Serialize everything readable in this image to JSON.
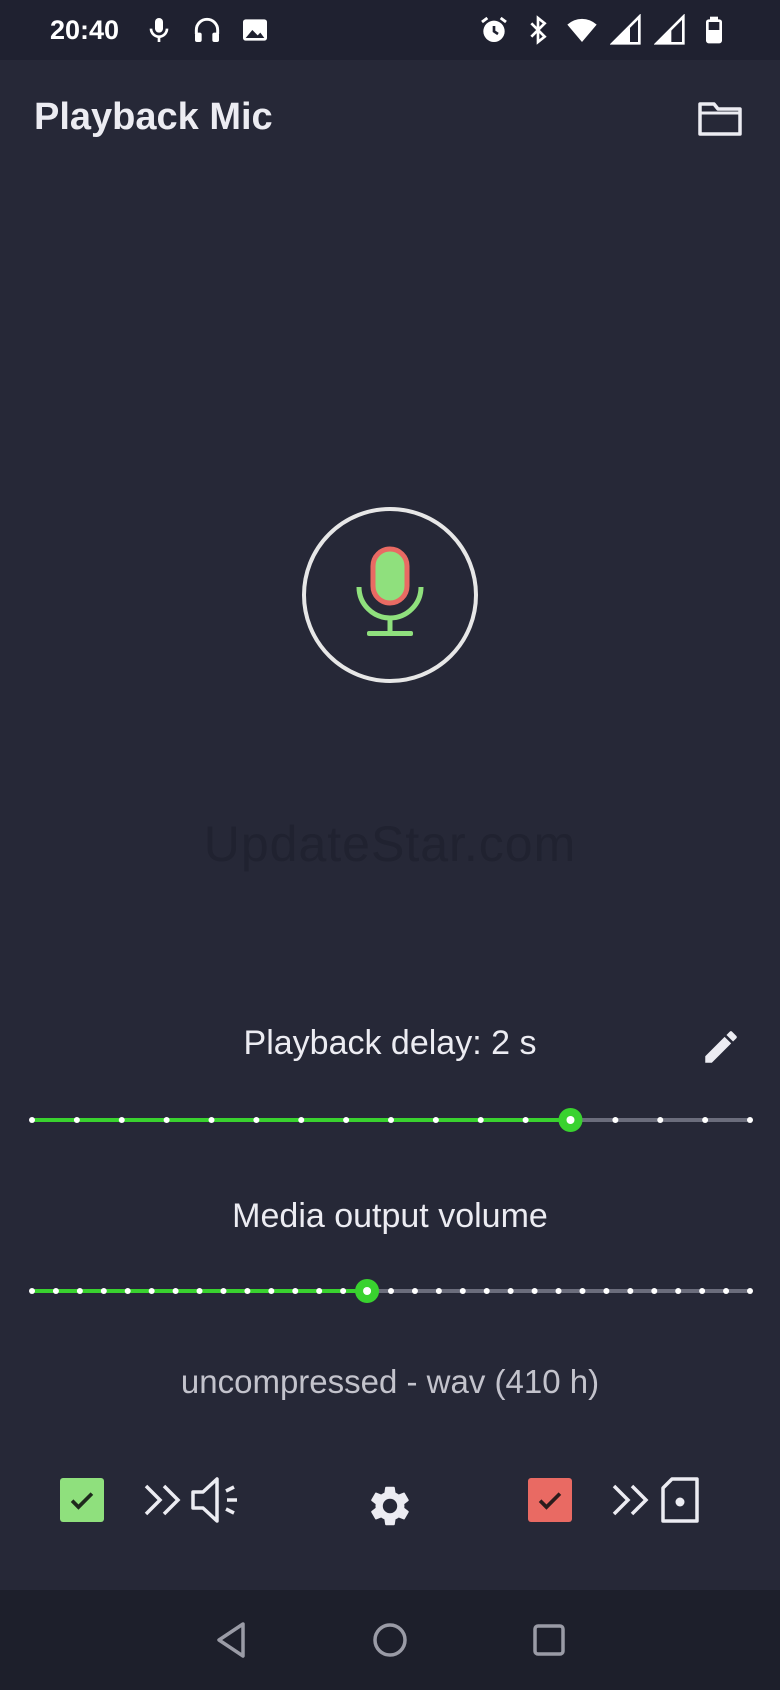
{
  "status_bar": {
    "time": "20:40",
    "left_icons": [
      "microphone-icon",
      "headphones-icon",
      "image-icon"
    ],
    "right_icons": [
      "alarm-icon",
      "bluetooth-icon",
      "wifi-icon",
      "signal-icon",
      "signal-roaming-icon",
      "battery-icon"
    ]
  },
  "app_bar": {
    "title": "Playback Mic",
    "folder_icon": "folder-icon"
  },
  "mic": {
    "icon": "microphone-icon",
    "colors": {
      "ring": "#e7e7e7",
      "body": "#8fe07d",
      "outline": "#e96a63",
      "stand": "#8fe07d"
    }
  },
  "watermark": "UpdateStar.com",
  "playback_delay": {
    "label": "Playback delay: 2 s",
    "edit_icon": "pencil-icon",
    "slider": {
      "steps": 17,
      "value_index": 12
    }
  },
  "media_volume": {
    "label": "Media output volume",
    "slider": {
      "steps": 31,
      "value_index": 14
    }
  },
  "format": "uncompressed - wav (410 h)",
  "bottom_controls": {
    "speaker_checkbox": {
      "checked": true,
      "color": "#8fe07d"
    },
    "speaker_target_icon": "speaker-icon",
    "arrows_icon": "double-chevron-right-icon",
    "settings_icon": "gear-icon",
    "file_checkbox": {
      "checked": true,
      "color": "#e96a63"
    },
    "file_target_icon": "file-icon"
  },
  "nav_bar": {
    "back_icon": "back-triangle-icon",
    "home_icon": "home-circle-icon",
    "recents_icon": "recents-square-icon"
  },
  "colors": {
    "background": "#262837",
    "accent_green": "#39d22f",
    "track_inactive": "#6b6d7c",
    "tick": "#ffffff"
  }
}
